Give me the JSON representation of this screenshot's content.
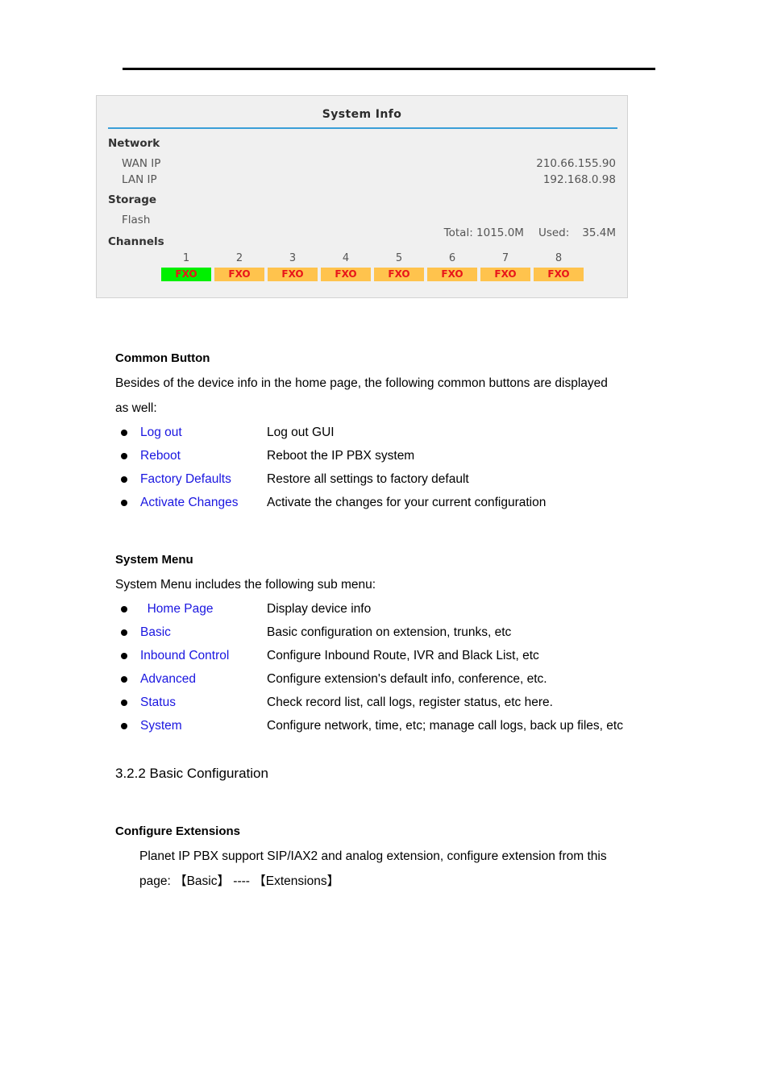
{
  "page": {
    "top_rule": "horizontal-rule"
  },
  "sysinfo": {
    "title": "System Info",
    "sections": {
      "network": {
        "heading": "Network",
        "rows": [
          {
            "label": "WAN IP",
            "value": "210.66.155.90"
          },
          {
            "label": "LAN IP",
            "value": "192.168.0.98"
          }
        ]
      },
      "storage": {
        "heading": "Storage",
        "row_label": "Flash",
        "total_label": "Total: 1015.0M",
        "used_label": "Used:",
        "used_value": "35.4M"
      },
      "channels": {
        "heading": "Channels",
        "items": [
          {
            "num": "1",
            "label": "FXO",
            "color": "#00f000",
            "state": "active"
          },
          {
            "num": "2",
            "label": "FXO",
            "color": "#ffc34d",
            "state": "idle"
          },
          {
            "num": "3",
            "label": "FXO",
            "color": "#ffc34d",
            "state": "idle"
          },
          {
            "num": "4",
            "label": "FXO",
            "color": "#ffc34d",
            "state": "idle"
          },
          {
            "num": "5",
            "label": "FXO",
            "color": "#ffc34d",
            "state": "idle"
          },
          {
            "num": "6",
            "label": "FXO",
            "color": "#ffc34d",
            "state": "idle"
          },
          {
            "num": "7",
            "label": "FXO",
            "color": "#ffc34d",
            "state": "idle"
          },
          {
            "num": "8",
            "label": "FXO",
            "color": "#ffc34d",
            "state": "idle"
          }
        ]
      }
    },
    "colors": {
      "panel_bg": "#f0f0f0",
      "rule": "#3a9fd8",
      "badge_text": "#e8161a"
    }
  },
  "common_button": {
    "heading": "Common Button",
    "intro_line1": "Besides of the device info in the home page, the following common buttons are displayed",
    "intro_line2": "as well:",
    "items": [
      {
        "link": "Log out",
        "desc": "Log out GUI"
      },
      {
        "link": "Reboot",
        "desc": "Reboot the IP PBX system"
      },
      {
        "link": "Factory Defaults",
        "desc": "Restore all settings to factory default"
      },
      {
        "link": "Activate Changes",
        "desc": "Activate the changes for your current configuration"
      }
    ]
  },
  "system_menu": {
    "heading": "System Menu",
    "intro": "System Menu includes the following sub menu:",
    "items": [
      {
        "link": "  Home Page",
        "desc": "Display device info"
      },
      {
        "link": "Basic",
        "desc": "Basic configuration on extension, trunks, etc"
      },
      {
        "link": "Inbound Control",
        "desc": "Configure Inbound Route, IVR and Black List, etc"
      },
      {
        "link": "Advanced",
        "desc": "Configure extension's default info, conference, etc."
      },
      {
        "link": "Status",
        "desc": "Check record list, call logs, register status, etc here."
      },
      {
        "link": "System",
        "desc": "Configure network, time, etc; manage call logs, back up files, etc"
      }
    ]
  },
  "basic_config": {
    "section_heading": "3.2.2 Basic Configuration",
    "sub_heading": "Configure Extensions",
    "body_line1": "Planet IP PBX support SIP/IAX2 and analog extension, configure extension from this",
    "body_line2": "page:  【Basic】 ---- 【Extensions】"
  },
  "colors": {
    "link": "#1a16e0",
    "text": "#000000"
  }
}
